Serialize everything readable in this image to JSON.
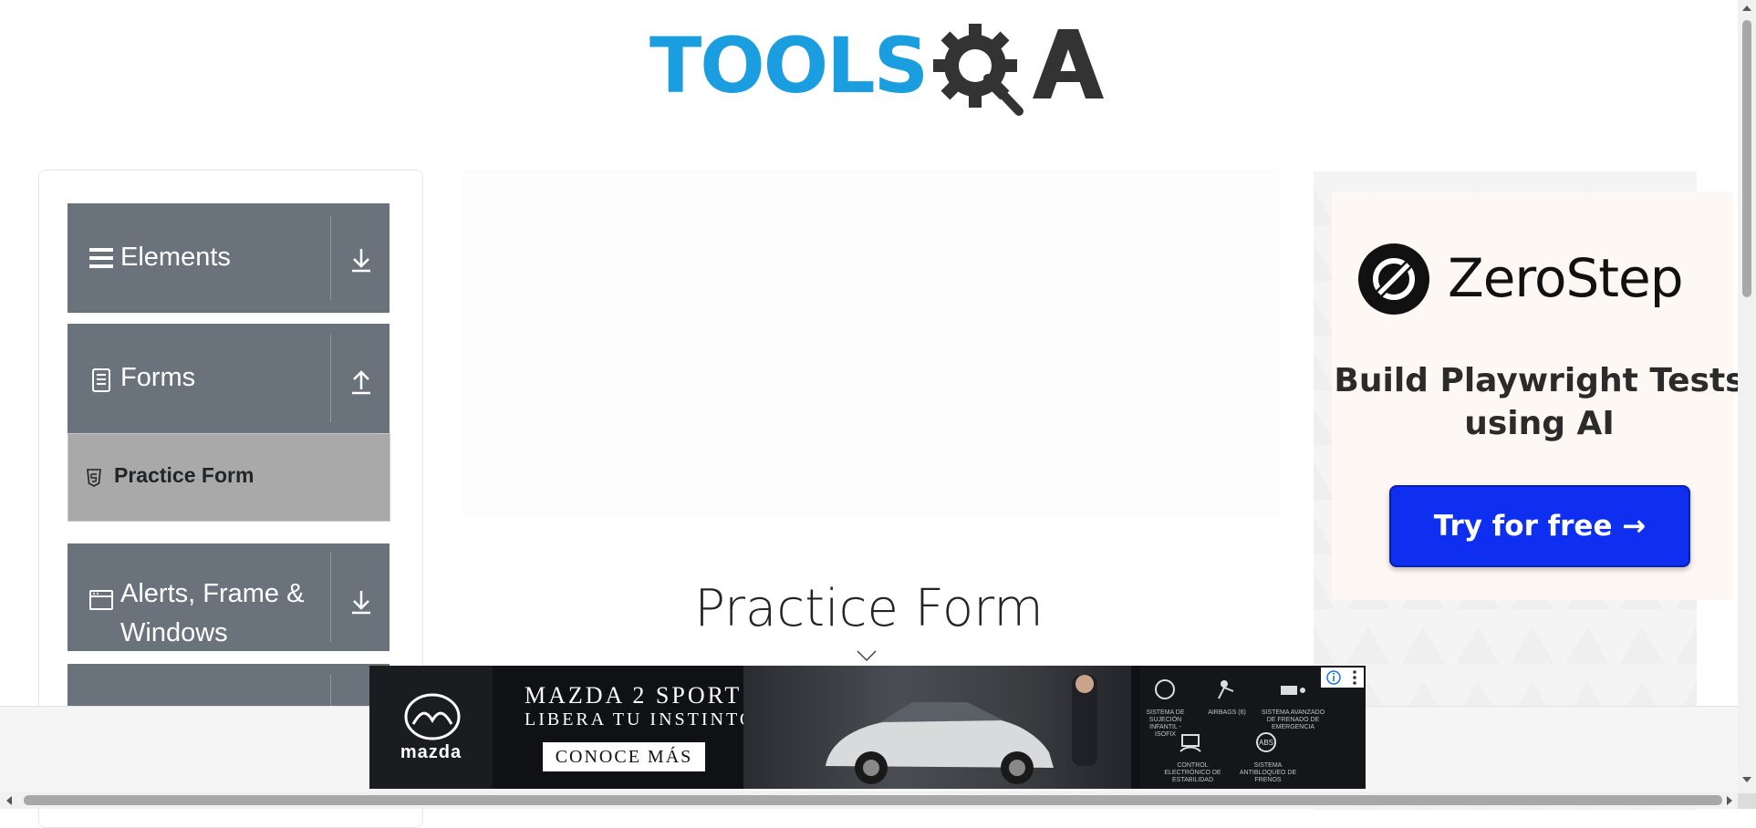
{
  "header": {
    "logo_text": "TOOLS",
    "logo_suffix": "A"
  },
  "sidebar": {
    "groups": [
      {
        "label": "Elements",
        "icon": "hamburger-icon",
        "toggle": "expand-down-icon",
        "expanded": false
      },
      {
        "label": "Forms",
        "icon": "form-icon",
        "toggle": "collapse-up-icon",
        "expanded": true,
        "items": [
          {
            "label": "Practice Form",
            "icon": "html5-icon",
            "active": true
          }
        ]
      },
      {
        "label": "Alerts, Frame & Windows",
        "icon": "window-icon",
        "toggle": "expand-down-icon",
        "expanded": false
      },
      {
        "label": "",
        "icon": "",
        "toggle": "",
        "expanded": false
      }
    ]
  },
  "main": {
    "title": "Practice Form"
  },
  "right_ad": {
    "brand": "ZeroStep",
    "headline": "Build Playwright Tests using AI",
    "cta": "Try for free →",
    "colors": {
      "cta_bg": "#0f2ff0",
      "panel_bg": "#fdf8f4"
    }
  },
  "bottom_ad": {
    "brand": "mazda",
    "headline": "MAZDA 2 SPORT",
    "tagline": "LIBERA TU INSTINTO",
    "cta": "CONOCE MÁS",
    "features": [
      "SISTEMA DE SUJECIÓN INFANTIL - ISOFIX",
      "AIRBAGS (6)",
      "SISTEMA AVANZADO DE FRENADO DE EMERGENCIA",
      "CONTROL ELECTRÓNICO DE ESTABILIDAD",
      "SISTEMA ANTIBLOQUEO DE FRENOS"
    ]
  },
  "colors": {
    "sidebar_header": "#6a737c",
    "sidebar_active": "#a9a9a9",
    "logo_blue": "#1a9ee0",
    "logo_dark": "#333333"
  }
}
